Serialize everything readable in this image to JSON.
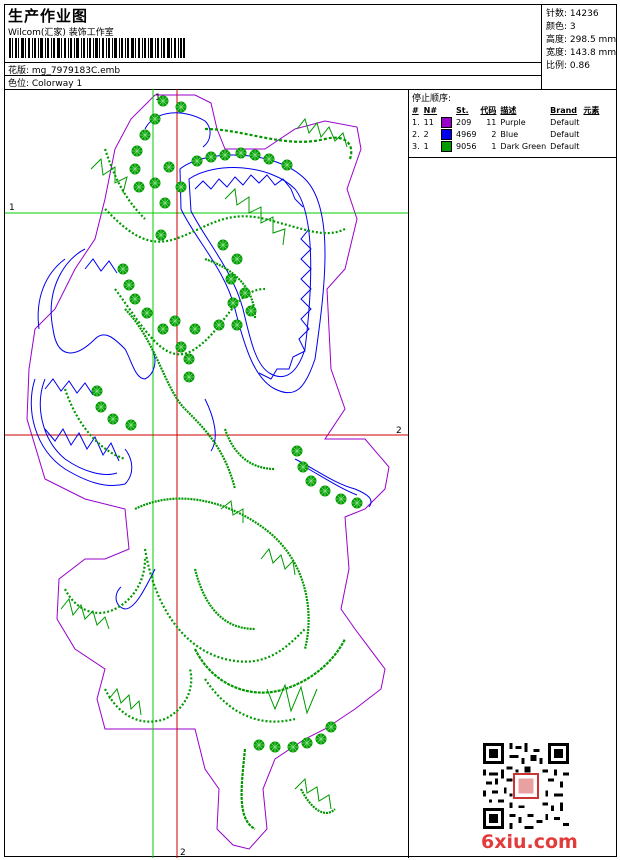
{
  "header": {
    "title": "生产作业图",
    "studio": "Wilcom(汇家) 装饰工作室",
    "design_label": "花版: mg_7979183C.emb",
    "colorway_label": "色位: Colorway 1"
  },
  "stats": [
    {
      "label": "针数:",
      "value": "14236"
    },
    {
      "label": "颜色:",
      "value": "3"
    },
    {
      "label": "高度:",
      "value": "298.5 mm"
    },
    {
      "label": "宽度:",
      "value": "143.8 mm"
    },
    {
      "label": "比例:",
      "value": "0.86"
    }
  ],
  "legend": {
    "caption": "停止顺序:",
    "headers": [
      "#",
      "N#",
      "St.",
      "代码",
      "描述",
      "Brand",
      "元素"
    ],
    "rows": [
      {
        "idx": "1.",
        "n": "11",
        "color": "#9900cc",
        "st": "209",
        "code": "11",
        "desc": "Purple",
        "brand": "Default"
      },
      {
        "idx": "2.",
        "n": "2",
        "color": "#0000ee",
        "st": "4969",
        "code": "2",
        "desc": "Blue",
        "brand": "Default"
      },
      {
        "idx": "3.",
        "n": "1",
        "color": "#009900",
        "st": "9056",
        "code": "1",
        "desc": "Dark Green",
        "brand": "Default"
      }
    ]
  },
  "axes": {
    "v1_label": "1",
    "h1_label": "1",
    "h2_label": "2",
    "v2_label": "2"
  },
  "colors": {
    "purple": "#9900cc",
    "blue": "#0000ee",
    "green": "#009900",
    "guide_green": "#00cc00",
    "guide_red": "#cc0000"
  },
  "watermark": "6xiu.com"
}
